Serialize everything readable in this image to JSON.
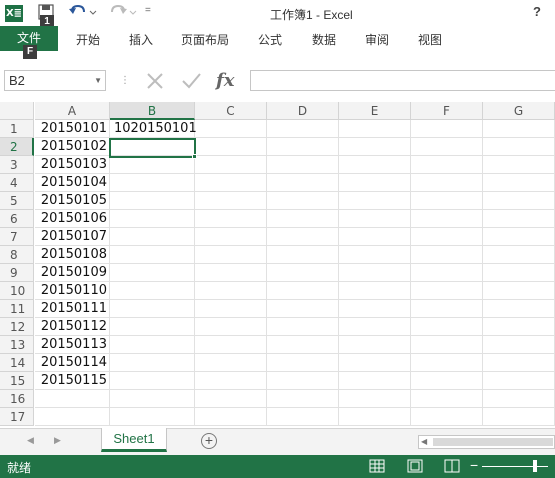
{
  "app": {
    "logo_text": "X≣",
    "title": "工作簿1 - Excel",
    "help": "?"
  },
  "qat": {
    "save_keytip": "1",
    "file_keytip": "F",
    "more": "="
  },
  "ribbon": {
    "tabs": [
      "文件",
      "开始",
      "插入",
      "页面布局",
      "公式",
      "数据",
      "审阅",
      "视图"
    ]
  },
  "formula_bar": {
    "name_box": "B2",
    "fx": "fx",
    "formula": ""
  },
  "grid": {
    "columns": [
      "A",
      "B",
      "C",
      "D",
      "E",
      "F",
      "G"
    ],
    "active_column": "B",
    "active_row": 2,
    "rows": [
      {
        "n": "1",
        "a": "20150101",
        "b": "1020150101"
      },
      {
        "n": "2",
        "a": "20150102",
        "b": ""
      },
      {
        "n": "3",
        "a": "20150103",
        "b": ""
      },
      {
        "n": "4",
        "a": "20150104",
        "b": ""
      },
      {
        "n": "5",
        "a": "20150105",
        "b": ""
      },
      {
        "n": "6",
        "a": "20150106",
        "b": ""
      },
      {
        "n": "7",
        "a": "20150107",
        "b": ""
      },
      {
        "n": "8",
        "a": "20150108",
        "b": ""
      },
      {
        "n": "9",
        "a": "20150109",
        "b": ""
      },
      {
        "n": "10",
        "a": "20150110",
        "b": ""
      },
      {
        "n": "11",
        "a": "20150111",
        "b": ""
      },
      {
        "n": "12",
        "a": "20150112",
        "b": ""
      },
      {
        "n": "13",
        "a": "20150113",
        "b": ""
      },
      {
        "n": "14",
        "a": "20150114",
        "b": ""
      },
      {
        "n": "15",
        "a": "20150115",
        "b": ""
      },
      {
        "n": "16",
        "a": "",
        "b": ""
      },
      {
        "n": "17",
        "a": "",
        "b": ""
      }
    ]
  },
  "sheets": {
    "active": "Sheet1",
    "add": "+"
  },
  "status": {
    "text": "就绪"
  },
  "colors": {
    "accent": "#217346"
  }
}
